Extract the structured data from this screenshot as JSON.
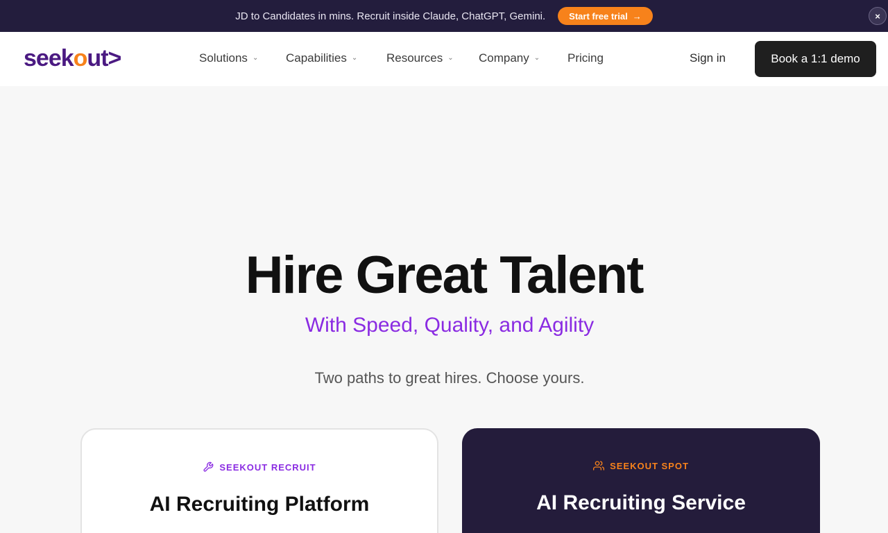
{
  "announcement": {
    "text": "JD to Candidates in mins. Recruit inside Claude, ChatGPT, Gemini.",
    "cta_label": "Start free trial",
    "cta_arrow": "→",
    "close_label": "×"
  },
  "nav": {
    "logo_main": "seek",
    "logo_o": "o",
    "logo_rest": "ut",
    "logo_chevron": ">",
    "items": [
      {
        "label": "Solutions",
        "has_dropdown": true
      },
      {
        "label": "Capabilities",
        "has_dropdown": true
      },
      {
        "label": "Resources",
        "has_dropdown": true
      },
      {
        "label": "Company",
        "has_dropdown": true
      },
      {
        "label": "Pricing",
        "has_dropdown": false
      }
    ],
    "caret": "⌄",
    "sign_in": "Sign in",
    "demo_label": "Book a 1:1 demo"
  },
  "hero": {
    "title": "Hire Great Talent",
    "subtitle": "With Speed, Quality, and Agility",
    "note": "Two paths to great hires. Choose yours."
  },
  "cards": [
    {
      "tag": "SEEKOUT RECRUIT",
      "title": "AI Recruiting Platform",
      "icon": "wrench-icon"
    },
    {
      "tag": "SEEKOUT SPOT",
      "title": "AI Recruiting Service",
      "icon": "users-icon"
    }
  ],
  "colors": {
    "brand_purple": "#4b1a82",
    "brand_orange": "#f7821b",
    "accent_purple": "#8a2be2",
    "banner_bg": "#231d3d",
    "dark_card": "#241c3b"
  }
}
